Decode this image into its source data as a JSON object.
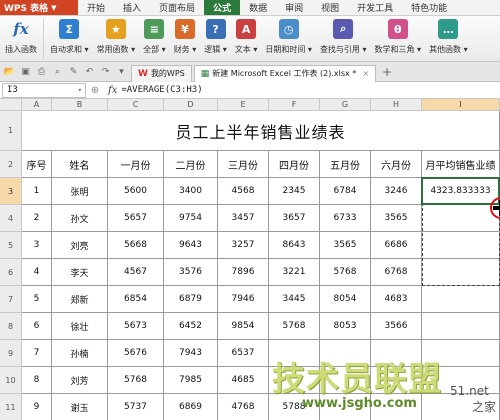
{
  "app": {
    "name": "WPS 表格",
    "caret": "▼"
  },
  "menu": [
    "开始",
    "插入",
    "页面布局",
    "公式",
    "数据",
    "审阅",
    "视图",
    "开发工具",
    "特色功能"
  ],
  "menu_active": "公式",
  "ribbon": [
    {
      "label": "插入函数",
      "icon": "fx-icon",
      "color": "#2a6bb0"
    },
    {
      "label": "自动求和 ▾",
      "icon": "sum-icon",
      "color": "#2f7fd0"
    },
    {
      "label": "常用函数 ▾",
      "icon": "star-icon",
      "color": "#e6a020"
    },
    {
      "label": "全部 ▾",
      "icon": "list-icon",
      "color": "#4e9a5a"
    },
    {
      "label": "财务 ▾",
      "icon": "finance-icon",
      "color": "#d86b2a"
    },
    {
      "label": "逻辑 ▾",
      "icon": "logic-icon",
      "color": "#3a6fb6"
    },
    {
      "label": "文本 ▾",
      "icon": "text-icon",
      "color": "#c84040"
    },
    {
      "label": "日期和时间 ▾",
      "icon": "clock-icon",
      "color": "#4a8ec9"
    },
    {
      "label": "查找与引用 ▾",
      "icon": "search-icon",
      "color": "#5a5ab0"
    },
    {
      "label": "数学和三角 ▾",
      "icon": "math-icon",
      "color": "#d0508a"
    },
    {
      "label": "其他函数 ▾",
      "icon": "more-icon",
      "color": "#2e9a8a"
    }
  ],
  "tabs": [
    {
      "label": "我的WPS",
      "icon": "wps-logo-icon",
      "active": false
    },
    {
      "label": "新建 Microsoft Excel 工作表 (2).xlsx *",
      "icon": "sheet-icon",
      "active": true
    }
  ],
  "tab_close": "×",
  "tab_add": "+",
  "formula_bar": {
    "namebox": "I3",
    "namebox_caret": "▾",
    "zoom_icon": "⊕",
    "fx": "fx",
    "formula": "=AVERAGE(C3:H3)"
  },
  "columns": [
    "A",
    "B",
    "C",
    "D",
    "E",
    "F",
    "G",
    "H",
    "I"
  ],
  "rows": [
    "1",
    "2",
    "3",
    "4",
    "5",
    "6",
    "7",
    "8",
    "9",
    "10",
    "11"
  ],
  "sheet_title": "员工上半年销售业绩表",
  "headers": [
    "序号",
    "姓名",
    "一月份",
    "二月份",
    "三月份",
    "四月份",
    "五月份",
    "六月份",
    "月平均销售业绩"
  ],
  "data_rows": [
    [
      "1",
      "张明",
      "5600",
      "3400",
      "4568",
      "2345",
      "6784",
      "3246",
      "4323.833333"
    ],
    [
      "2",
      "孙文",
      "5657",
      "9754",
      "3457",
      "3657",
      "6733",
      "3565",
      ""
    ],
    [
      "3",
      "刘亮",
      "5668",
      "9643",
      "3257",
      "8643",
      "3565",
      "6686",
      ""
    ],
    [
      "4",
      "李天",
      "4567",
      "3576",
      "7896",
      "3221",
      "5768",
      "6768",
      ""
    ],
    [
      "5",
      "郑新",
      "6854",
      "6879",
      "7946",
      "3445",
      "8054",
      "4683",
      ""
    ],
    [
      "6",
      "徐壮",
      "5673",
      "6452",
      "9854",
      "5768",
      "8053",
      "3566",
      ""
    ],
    [
      "7",
      "孙楠",
      "5676",
      "7943",
      "6537",
      "",
      "",
      "",
      ""
    ],
    [
      "8",
      "刘芳",
      "5768",
      "7985",
      "4685",
      "",
      "",
      "",
      ""
    ],
    [
      "9",
      "谢玉",
      "5737",
      "6869",
      "4768",
      "5788",
      "",
      "",
      ""
    ]
  ],
  "watermark": {
    "main": "技术员联盟",
    "url": "www.jsgho.com",
    "side": "51.net",
    "side2": "之家"
  }
}
